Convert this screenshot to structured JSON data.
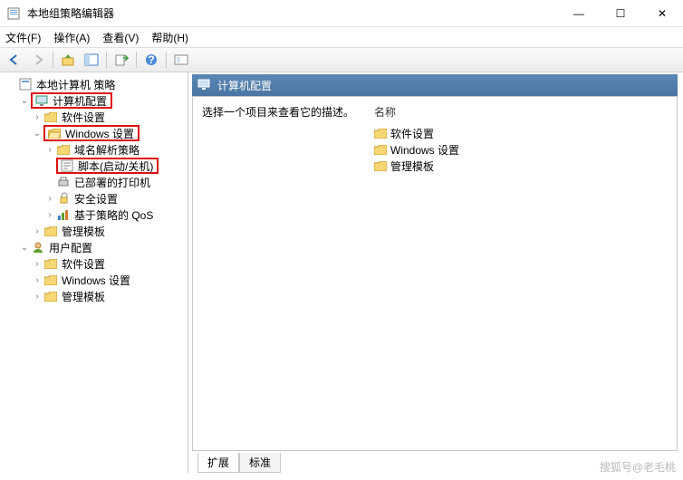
{
  "window": {
    "title": "本地组策略编辑器",
    "min": "—",
    "max": "☐",
    "close": "✕"
  },
  "menu": {
    "file": "文件(F)",
    "action": "操作(A)",
    "view": "查看(V)",
    "help": "帮助(H)"
  },
  "tree": {
    "root": "本地计算机 策略",
    "computer_config": "计算机配置",
    "software_settings": "软件设置",
    "windows_settings": "Windows 设置",
    "dns_policy": "域名解析策略",
    "scripts": "脚本(启动/关机)",
    "deployed_printers": "已部署的打印机",
    "security": "安全设置",
    "qos": "基于策略的 QoS",
    "admin_templates": "管理模板",
    "user_config": "用户配置",
    "u_software": "软件设置",
    "u_windows": "Windows 设置",
    "u_admin": "管理模板"
  },
  "detail": {
    "header": "计算机配置",
    "description": "选择一个项目来查看它的描述。",
    "name_col": "名称",
    "items": [
      "软件设置",
      "Windows 设置",
      "管理模板"
    ]
  },
  "tabs": {
    "extended": "扩展",
    "standard": "标准"
  },
  "watermark": "搜狐号@老毛桃"
}
